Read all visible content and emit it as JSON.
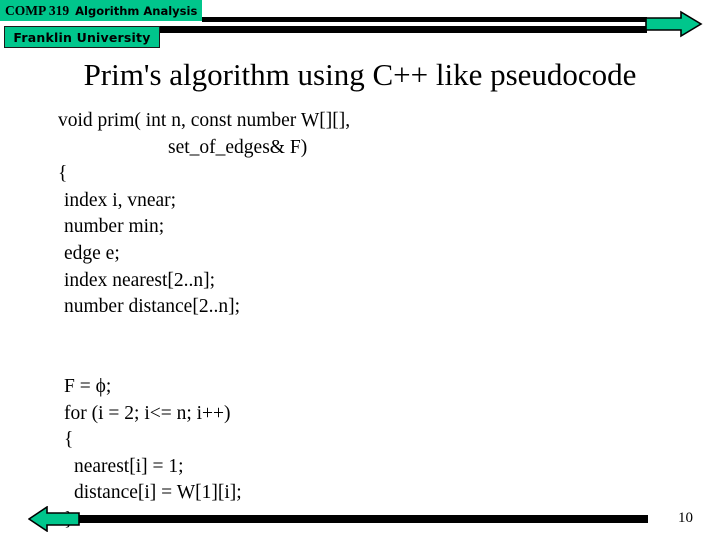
{
  "header": {
    "course_code": "COMP 319",
    "course_name": "Algorithm Analysis",
    "school": "Franklin University",
    "accent_color": "#00C68C",
    "bar_color": "#000000",
    "forward_arrow_icon": "arrow-right-icon"
  },
  "title": "Prim's algorithm using C++ like  pseudocode",
  "code": {
    "lines": [
      {
        "text": "void prim( int n, const number W[][],",
        "indent": "ind0"
      },
      {
        "text": "set_of_edges& F)",
        "indent": "center-ind"
      },
      {
        "text": "{",
        "indent": "ind0"
      },
      {
        "text": "index i, vnear;",
        "indent": "ind1"
      },
      {
        "text": "number min;",
        "indent": "ind1"
      },
      {
        "text": "edge e;",
        "indent": "ind1"
      },
      {
        "text": "index nearest[2..n];",
        "indent": "ind1"
      },
      {
        "text": "number distance[2..n];",
        "indent": "ind1"
      },
      {
        "text": "",
        "indent": "blank"
      },
      {
        "text": "",
        "indent": "blank"
      },
      {
        "text": "F = ϕ;",
        "indent": "ind1"
      },
      {
        "text": "for (i = 2; i<= n; i++)",
        "indent": "ind1"
      },
      {
        "text": "{",
        "indent": "ind1"
      },
      {
        "text": "nearest[i] = 1;",
        "indent": "ind3"
      },
      {
        "text": "distance[i] = W[1][i];",
        "indent": "ind3"
      },
      {
        "text": "}",
        "indent": "ind1"
      }
    ]
  },
  "footer": {
    "page_number": "10",
    "back_arrow_icon": "arrow-left-icon",
    "bar_color": "#000000",
    "accent_color": "#00C68C"
  }
}
